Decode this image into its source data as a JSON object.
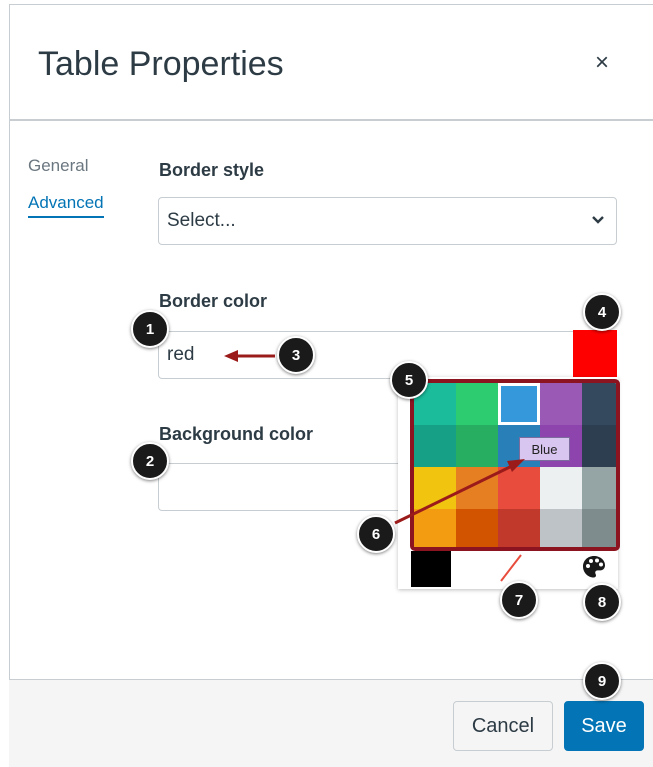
{
  "dialog": {
    "title": "Table Properties",
    "close_glyph": "×"
  },
  "tabs": [
    {
      "label": "General",
      "active": false
    },
    {
      "label": "Advanced",
      "active": true
    }
  ],
  "border_style": {
    "label": "Border style",
    "selected": "Select..."
  },
  "border_color": {
    "label": "Border color",
    "value": "red",
    "swatch_color": "#ff0000"
  },
  "background_color": {
    "label": "Background color",
    "value": ""
  },
  "palette": {
    "colors": [
      "#1abc9c",
      "#2ecc71",
      "#3498db",
      "#9b59b6",
      "#34495e",
      "#16a085",
      "#27ae60",
      "#2980b9",
      "#8e44ad",
      "#2c3e50",
      "#f1c40f",
      "#e67e22",
      "#e74c3c",
      "#ecf0f1",
      "#95a5a6",
      "#f39c12",
      "#d35400",
      "#c0392b",
      "#bdc3c7",
      "#7f8c8d"
    ],
    "selected_index": 2,
    "tooltip": "Blue",
    "black_color": "#000000",
    "highlight_color": "#8b1420",
    "custom_icon": "palette-icon",
    "remove_icon": "no-color-slash-icon"
  },
  "footer": {
    "cancel_label": "Cancel",
    "save_label": "Save"
  },
  "callouts": [
    "1",
    "2",
    "3",
    "4",
    "5",
    "6",
    "7",
    "8",
    "9"
  ],
  "accent_color": "#0374b5"
}
